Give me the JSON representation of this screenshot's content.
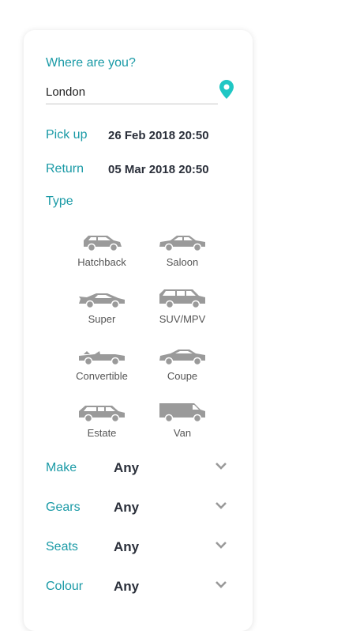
{
  "location": {
    "label": "Where are you?",
    "value": "London"
  },
  "pickup": {
    "label": "Pick up",
    "value": "26 Feb 2018 20:50"
  },
  "return": {
    "label": "Return",
    "value": "05 Mar 2018 20:50"
  },
  "type": {
    "label": "Type",
    "options": [
      {
        "label": "Hatchback",
        "icon": "hatchback-icon"
      },
      {
        "label": "Saloon",
        "icon": "saloon-icon"
      },
      {
        "label": "Super",
        "icon": "supercar-icon"
      },
      {
        "label": "SUV/MPV",
        "icon": "suv-icon"
      },
      {
        "label": "Convertible",
        "icon": "convertible-icon"
      },
      {
        "label": "Coupe",
        "icon": "coupe-icon"
      },
      {
        "label": "Estate",
        "icon": "estate-icon"
      },
      {
        "label": "Van",
        "icon": "van-icon"
      }
    ]
  },
  "filters": {
    "make": {
      "label": "Make",
      "value": "Any"
    },
    "gears": {
      "label": "Gears",
      "value": "Any"
    },
    "seats": {
      "label": "Seats",
      "value": "Any"
    },
    "colour": {
      "label": "Colour",
      "value": "Any"
    }
  },
  "colors": {
    "accent": "#1a9aa6",
    "pin": "#1fc7c4",
    "icon": "#9a9a9a",
    "value_text": "#2a2f3a"
  }
}
